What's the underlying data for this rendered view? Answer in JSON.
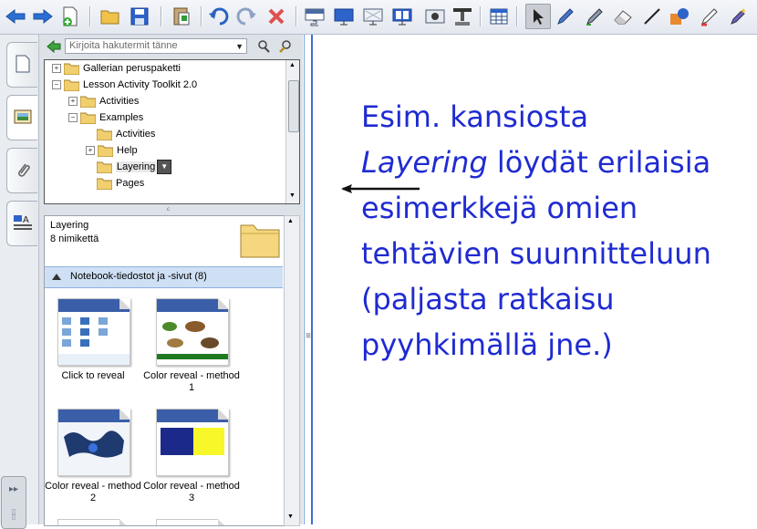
{
  "toolbar": {
    "buttons": [
      "back-icon",
      "forward-icon",
      "new-page-icon",
      "open-icon",
      "save-icon",
      "paste-icon",
      "undo-icon",
      "redo-icon",
      "delete-icon",
      "screen-shade-icon",
      "fullscreen-icon",
      "transparent-bg-icon",
      "dual-page-icon",
      "capture-icon",
      "document-camera-icon",
      "table-icon",
      "select-icon",
      "pen-icon",
      "creative-pen-icon",
      "eraser-icon",
      "line-icon",
      "shape-icon",
      "magic-pen-icon",
      "fill-icon"
    ],
    "selected": "select-icon"
  },
  "side_tabs": [
    "page-sorter-icon",
    "gallery-icon",
    "attachments-icon",
    "properties-icon"
  ],
  "gallery": {
    "search_placeholder": "Kirjoita hakutermit tänne",
    "tree": [
      {
        "label": "Gallerian peruspaketti",
        "level": 0,
        "toggle": "+"
      },
      {
        "label": "Lesson Activity Toolkit 2.0",
        "level": 0,
        "toggle": "-"
      },
      {
        "label": "Activities",
        "level": 1,
        "toggle": "+"
      },
      {
        "label": "Examples",
        "level": 1,
        "toggle": "-"
      },
      {
        "label": "Activities",
        "level": 2,
        "toggle": ""
      },
      {
        "label": "Help",
        "level": 2,
        "toggle": "+"
      },
      {
        "label": "Layering",
        "level": 2,
        "toggle": "",
        "selected": true
      },
      {
        "label": "Pages",
        "level": 2,
        "toggle": ""
      }
    ],
    "collection_title": "Layering",
    "collection_count": "8 nimikettä",
    "group_label": "Notebook-tiedostot ja -sivut (8)",
    "items": [
      {
        "label": "Click to reveal"
      },
      {
        "label": "Color reveal - method 1"
      },
      {
        "label": "Color reveal - method 2"
      },
      {
        "label": "Color reveal - method 3"
      }
    ]
  },
  "canvas_note": {
    "line1": "Esim. kansiosta",
    "line2_italic": "Layering",
    "line2_rest": " löydät erilaisia",
    "line3": "esimerkkejä omien",
    "line4": "tehtävien suunnitteluun",
    "line5": "(paljasta ratkaisu",
    "line6": "pyyhkimällä jne.)",
    "color": "#1f2bd1"
  }
}
